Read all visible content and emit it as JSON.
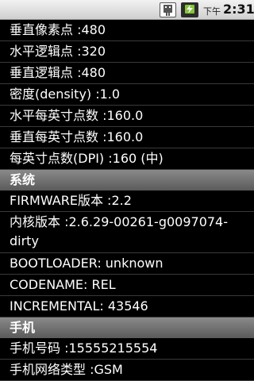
{
  "status_bar": {
    "usb_icon": "usb-debug-icon",
    "battery_icon": "battery-charging-icon",
    "am_pm": "下午",
    "time": "2:31"
  },
  "rows_top": [
    "垂直像素点 :480",
    "水平逻辑点 :320",
    "垂直逻辑点 :480",
    "密度(density) :1.0",
    "水平每英寸点数 :160.0",
    "垂直每英寸点数 :160.0",
    "每英寸点数(DPI) :160 (中)"
  ],
  "section_system": "系统",
  "rows_system": [
    "FIRMWARE版本 :2.2",
    "内核版本 :2.6.29-00261-g0097074-dirty",
    "BOOTLOADER: unknown",
    "CODENAME: REL",
    "INCREMENTAL: 43546"
  ],
  "section_phone": "手机",
  "rows_phone": [
    "手机号码 :15555215554",
    "手机网络类型 :GSM"
  ],
  "colors": {
    "background": "#000000",
    "section_header": "#6e6e6e",
    "status_bar": "#e0e0e0"
  }
}
